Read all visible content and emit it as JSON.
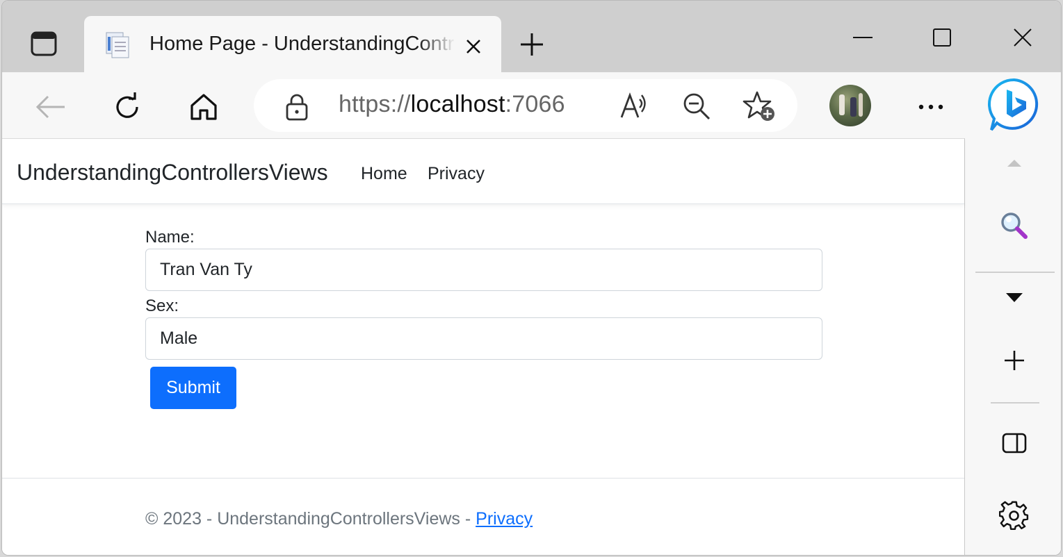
{
  "tab": {
    "title": "Home Page - UnderstandingControllersViews"
  },
  "omnibox": {
    "url_scheme": "https://",
    "url_host": "localhost",
    "url_port": ":7066"
  },
  "icons": {
    "tab_actions": "tab-actions-icon",
    "favicon": "page-favicon-icon",
    "tab_close": "close-icon",
    "new_tab": "plus-icon",
    "minimize": "minimize-icon",
    "maximize": "maximize-icon",
    "close_window": "close-icon",
    "back": "back-arrow-icon",
    "refresh": "refresh-icon",
    "home": "home-icon",
    "lock": "lock-icon",
    "read_aloud": "read-aloud-icon",
    "zoom_out": "zoom-out-icon",
    "add_favorite": "star-plus-icon",
    "more": "ellipsis-icon",
    "copilot": "bing-copilot-icon",
    "search": "search-icon",
    "scroll_up": "scroll-up-icon",
    "scroll_down": "scroll-down-icon",
    "add": "plus-icon",
    "split": "sidebar-toggle-icon",
    "settings": "gear-icon"
  },
  "navbar": {
    "brand": "UnderstandingControllersViews",
    "links": [
      {
        "label": "Home"
      },
      {
        "label": "Privacy"
      }
    ]
  },
  "form": {
    "name_label": "Name:",
    "name_value": "Tran Van Ty",
    "sex_label": "Sex:",
    "sex_value": "Male",
    "submit_label": "Submit"
  },
  "footer": {
    "text": "© 2023 - UnderstandingControllersViews - ",
    "link": "Privacy"
  },
  "colors": {
    "primary": "#0d6efd",
    "text": "#212529",
    "muted": "#6c757d",
    "chrome": "#f7f7f7",
    "tabbar": "#cfcfcf"
  }
}
